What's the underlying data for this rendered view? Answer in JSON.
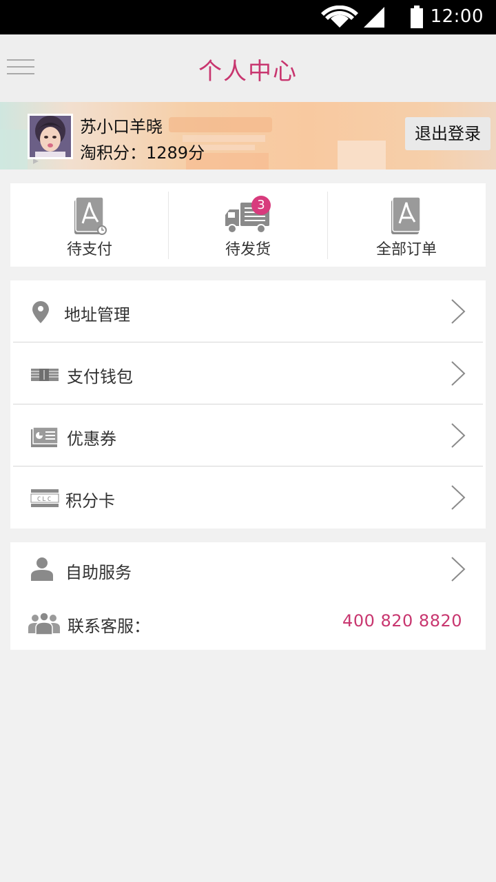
{
  "status_bar": {
    "time": "12:00",
    "icons": [
      "wifi-icon",
      "signal-icon",
      "battery-icon"
    ]
  },
  "header": {
    "title": "个人中心",
    "menu_icon": "hamburger-menu-icon"
  },
  "user": {
    "name": "苏小口羊晓",
    "points_text": "淘积分：1289分",
    "logout_label": "退出登录"
  },
  "orders": [
    {
      "label": "待支付",
      "icon": "document-clock-icon"
    },
    {
      "label": "待发货",
      "icon": "truck-icon",
      "badge": "3"
    },
    {
      "label": "全部订单",
      "icon": "document-icon"
    }
  ],
  "menu": [
    {
      "label": "地址管理",
      "icon": "location-pin-icon"
    },
    {
      "label": "支付钱包",
      "icon": "wallet-icon"
    },
    {
      "label": "优惠券",
      "icon": "coupon-icon"
    },
    {
      "label": "积分卡",
      "icon": "points-card-icon",
      "card_text": "CLC"
    }
  ],
  "service": {
    "self_service_label": "自助服务",
    "contact_label": "联系客服：",
    "phone": "400 820 8820"
  },
  "colors": {
    "accent": "#c8366f",
    "badge": "#d83b7d",
    "background": "#f1f1f1",
    "icon_gray": "#8a8a8a"
  }
}
